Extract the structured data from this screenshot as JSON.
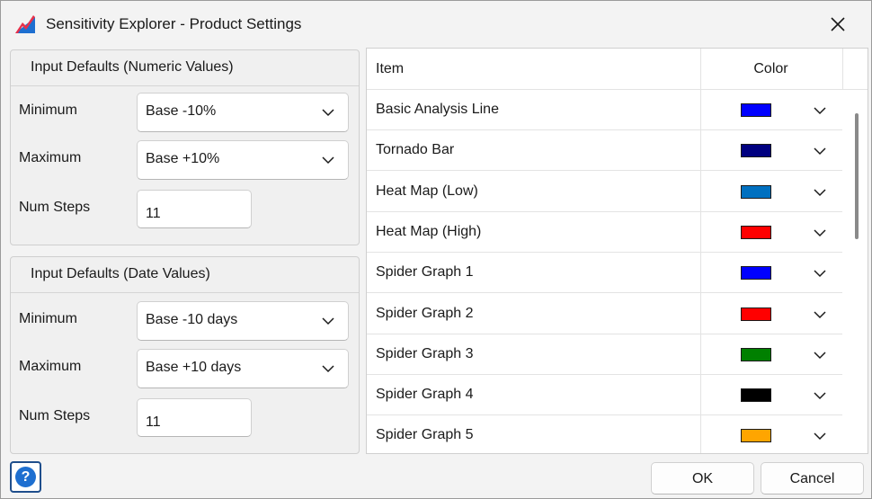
{
  "window": {
    "title": "Sensitivity Explorer - Product Settings",
    "icon": "app-logo-icon"
  },
  "numeric_group": {
    "header": "Input Defaults (Numeric Values)",
    "minimum_label": "Minimum",
    "minimum_value": "Base -10%",
    "maximum_label": "Maximum",
    "maximum_value": "Base +10%",
    "steps_label": "Num Steps",
    "steps_value": "11"
  },
  "date_group": {
    "header": "Input Defaults (Date Values)",
    "minimum_label": "Minimum",
    "minimum_value": "Base -10 days",
    "maximum_label": "Maximum",
    "maximum_value": "Base +10 days",
    "steps_label": "Num Steps",
    "steps_value": "11"
  },
  "color_table": {
    "col_item": "Item",
    "col_color": "Color",
    "rows": [
      {
        "name": "Basic Analysis Line",
        "color": "#0000ff"
      },
      {
        "name": "Tornado Bar",
        "color": "#000080"
      },
      {
        "name": "Heat Map (Low)",
        "color": "#0070c0"
      },
      {
        "name": "Heat Map (High)",
        "color": "#ff0000"
      },
      {
        "name": "Spider Graph 1",
        "color": "#0000ff"
      },
      {
        "name": "Spider Graph 2",
        "color": "#ff0000"
      },
      {
        "name": "Spider Graph 3",
        "color": "#008000"
      },
      {
        "name": "Spider Graph 4",
        "color": "#000000"
      },
      {
        "name": "Spider Graph 5",
        "color": "#ffa500"
      }
    ]
  },
  "footer": {
    "help_glyph": "?",
    "ok_label": "OK",
    "cancel_label": "Cancel"
  }
}
